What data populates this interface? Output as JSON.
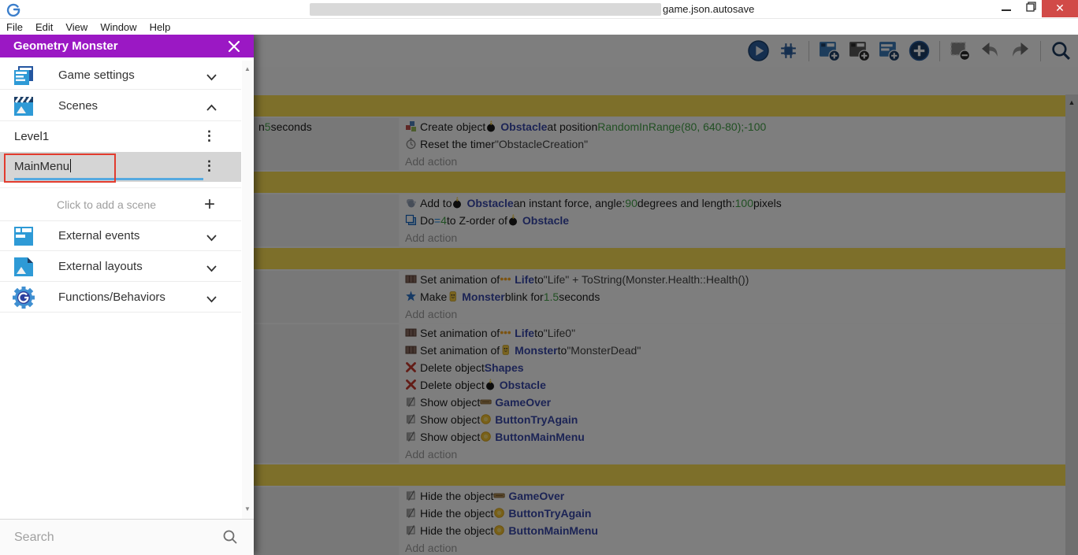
{
  "window": {
    "title_visible": "game.json.autosave",
    "title_redacted": true,
    "controls": {
      "minimize": "minimize",
      "restore": "restore",
      "close": "✕"
    },
    "close_color": "#d14a47"
  },
  "menubar": {
    "items": [
      "File",
      "Edit",
      "View",
      "Window",
      "Help"
    ]
  },
  "toolbar": {
    "icons": [
      "play-icon",
      "debug-icon",
      "separator",
      "add-event-icon",
      "add-subevent-icon",
      "add-comment-icon",
      "add-circle-icon",
      "separator",
      "remove-event-icon",
      "undo-icon",
      "redo-icon",
      "separator",
      "search-icon"
    ]
  },
  "drawer": {
    "title": "Geometry Monster",
    "items": [
      {
        "type": "section",
        "label": "Game settings",
        "icon": "game-settings-icon",
        "chevron": "down"
      },
      {
        "type": "section",
        "label": "Scenes",
        "icon": "scenes-icon",
        "chevron": "up"
      },
      {
        "type": "scene",
        "label": "Level1"
      },
      {
        "type": "scene-editing",
        "value": "MainMenu",
        "highlighted": true
      },
      {
        "type": "add-scene",
        "label": "Click to add a scene"
      },
      {
        "type": "section",
        "label": "External events",
        "icon": "external-events-icon",
        "chevron": "down"
      },
      {
        "type": "section",
        "label": "External layouts",
        "icon": "external-layouts-icon",
        "chevron": "down"
      },
      {
        "type": "section",
        "label": "Functions/Behaviors",
        "icon": "functions-icon",
        "chevron": "down"
      }
    ],
    "search_placeholder": "Search"
  },
  "colors": {
    "drawer_header": "#9b18c4",
    "annotation_red": "#e23b2e",
    "edit_underline_blue": "#55a9e0",
    "comment_yellow": "#fadf55",
    "object_blue": "#3949ab",
    "param_green": "#43a047",
    "close_red": "#d14a47"
  },
  "events_sheet": {
    "blocks": [
      {
        "type": "comment"
      },
      {
        "type": "event",
        "conditions": [
          [
            {
              "t": "n ",
              "s": "p"
            },
            {
              "t": "5",
              "s": "g"
            },
            {
              "t": " seconds",
              "s": "p"
            }
          ]
        ],
        "actions": [
          [
            {
              "i": "create-object-icon"
            },
            {
              "t": "Create object ",
              "s": "p"
            },
            {
              "i": "bomb-icon"
            },
            {
              "t": "Obstacle",
              "s": "o"
            },
            {
              "t": " at position ",
              "s": "p"
            },
            {
              "t": "RandomInRange(80, 640-80);-100",
              "s": "g"
            }
          ],
          [
            {
              "i": "timer-icon"
            },
            {
              "t": "Reset the timer ",
              "s": "p"
            },
            {
              "t": "\"ObstacleCreation\"",
              "s": "str"
            }
          ],
          [
            {
              "t": "Add action",
              "s": "add"
            }
          ]
        ]
      },
      {
        "type": "comment"
      },
      {
        "type": "event",
        "conditions": [],
        "actions": [
          [
            {
              "i": "force-icon"
            },
            {
              "t": "Add to ",
              "s": "p"
            },
            {
              "i": "bomb-icon"
            },
            {
              "t": "Obstacle",
              "s": "o"
            },
            {
              "t": " an instant force, angle: ",
              "s": "p"
            },
            {
              "t": "90",
              "s": "g"
            },
            {
              "t": " degrees and length: ",
              "s": "p"
            },
            {
              "t": "100",
              "s": "g"
            },
            {
              "t": " pixels",
              "s": "p"
            }
          ],
          [
            {
              "i": "zorder-icon"
            },
            {
              "t": "Do ",
              "s": "p"
            },
            {
              "t": "=",
              "s": "b"
            },
            {
              "t": "4",
              "s": "g"
            },
            {
              "t": " to Z-order of ",
              "s": "p"
            },
            {
              "i": "bomb-icon"
            },
            {
              "t": "Obstacle",
              "s": "o"
            }
          ],
          [
            {
              "t": "Add action",
              "s": "add"
            }
          ]
        ]
      },
      {
        "type": "comment"
      },
      {
        "type": "event",
        "conditions": [],
        "actions": [
          [
            {
              "i": "animation-icon"
            },
            {
              "t": "Set animation of ",
              "s": "p"
            },
            {
              "i": "life-dots-icon"
            },
            {
              "t": "Life",
              "s": "o"
            },
            {
              "t": " to ",
              "s": "p"
            },
            {
              "t": "\"Life\" + ToString(Monster.Health::Health())",
              "s": "str"
            }
          ],
          [
            {
              "i": "blink-icon"
            },
            {
              "t": "Make ",
              "s": "p"
            },
            {
              "i": "monster-icon"
            },
            {
              "t": "Monster",
              "s": "o"
            },
            {
              "t": " blink for ",
              "s": "p"
            },
            {
              "t": "1.5",
              "s": "g"
            },
            {
              "t": " seconds",
              "s": "p"
            }
          ],
          [
            {
              "t": "Add action",
              "s": "add"
            }
          ]
        ]
      },
      {
        "type": "event",
        "conditions": [],
        "actions": [
          [
            {
              "i": "animation-icon"
            },
            {
              "t": "Set animation of ",
              "s": "p"
            },
            {
              "i": "life-dots-icon"
            },
            {
              "t": "Life",
              "s": "o"
            },
            {
              "t": " to ",
              "s": "p"
            },
            {
              "t": "\"Life0\"",
              "s": "str"
            }
          ],
          [
            {
              "i": "animation-icon"
            },
            {
              "t": "Set animation of ",
              "s": "p"
            },
            {
              "i": "monster-icon"
            },
            {
              "t": "Monster",
              "s": "o"
            },
            {
              "t": " to ",
              "s": "p"
            },
            {
              "t": "\"MonsterDead\"",
              "s": "str"
            }
          ],
          [
            {
              "i": "delete-icon"
            },
            {
              "t": "Delete object ",
              "s": "p"
            },
            {
              "t": "Shapes",
              "s": "o"
            }
          ],
          [
            {
              "i": "delete-icon"
            },
            {
              "t": "Delete object ",
              "s": "p"
            },
            {
              "i": "bomb-icon"
            },
            {
              "t": "Obstacle",
              "s": "o"
            }
          ],
          [
            {
              "i": "visibility-icon"
            },
            {
              "t": "Show object ",
              "s": "p"
            },
            {
              "i": "gameover-icon"
            },
            {
              "t": "GameOver",
              "s": "o"
            }
          ],
          [
            {
              "i": "visibility-icon"
            },
            {
              "t": "Show object ",
              "s": "p"
            },
            {
              "i": "button-icon"
            },
            {
              "t": "ButtonTryAgain",
              "s": "o"
            }
          ],
          [
            {
              "i": "visibility-icon"
            },
            {
              "t": "Show object ",
              "s": "p"
            },
            {
              "i": "button-icon"
            },
            {
              "t": "ButtonMainMenu",
              "s": "o"
            }
          ],
          [
            {
              "t": "Add action",
              "s": "add"
            }
          ]
        ]
      },
      {
        "type": "comment"
      },
      {
        "type": "event",
        "conditions": [],
        "actions": [
          [
            {
              "i": "visibility-icon"
            },
            {
              "t": "Hide the object ",
              "s": "p"
            },
            {
              "i": "gameover-icon"
            },
            {
              "t": "GameOver",
              "s": "o"
            }
          ],
          [
            {
              "i": "visibility-icon"
            },
            {
              "t": "Hide the object ",
              "s": "p"
            },
            {
              "i": "button-icon"
            },
            {
              "t": "ButtonTryAgain",
              "s": "o"
            }
          ],
          [
            {
              "i": "visibility-icon"
            },
            {
              "t": "Hide the object ",
              "s": "p"
            },
            {
              "i": "button-icon"
            },
            {
              "t": "ButtonMainMenu",
              "s": "o"
            }
          ],
          [
            {
              "t": "Add action",
              "s": "add"
            }
          ]
        ]
      }
    ]
  }
}
